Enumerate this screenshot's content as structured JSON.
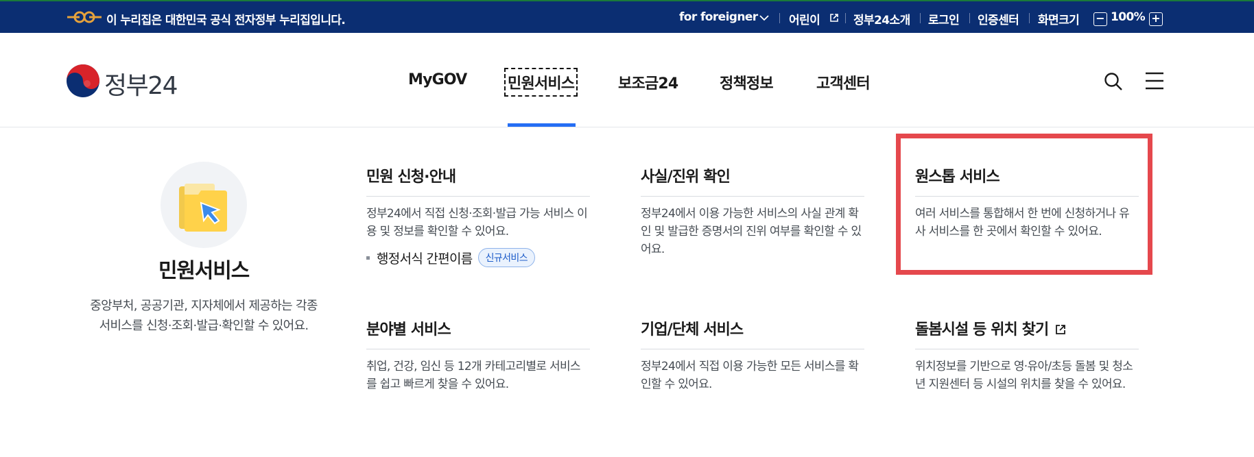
{
  "gov_banner": {
    "text": "이 누리집은 대한민국 공식 전자정부 누리집입니다.",
    "utility_links": [
      "for foreigner",
      "어린이",
      "정부24소개",
      "로그인",
      "인증센터"
    ],
    "zoom_label": "화면크기",
    "zoom_minus": "−",
    "zoom_value": "100%",
    "zoom_plus": "+"
  },
  "header": {
    "logo_text": "정부24",
    "nav": [
      "MyGOV",
      "민원서비스",
      "보조금24",
      "정책정보",
      "고객센터"
    ],
    "active_nav": "민원서비스"
  },
  "mega_menu": {
    "intro": {
      "title": "민원서비스",
      "description": "중앙부처, 공공기관, 지자체에서 제공하는 각종 서비스를 신청·조회·발급·확인할 수 있어요."
    },
    "cards": [
      {
        "title": "민원 신청·안내",
        "description": "정부24에서 직접 신청·조회·발급 가능 서비스 이용 및 정보를 확인할 수 있어요.",
        "sub_link": "행정서식 간편이름",
        "sub_badge": "신규서비스"
      },
      {
        "title": "사실/진위 확인",
        "description": "정부24에서 이용 가능한 서비스의 사실 관계 확인 및 발급한 증명서의 진위 여부를 확인할 수 있어요."
      },
      {
        "title": "원스톱 서비스",
        "description": "여러 서비스를 통합해서 한 번에 신청하거나 유사 서비스를 한 곳에서 확인할 수 있어요."
      },
      {
        "title": "분야별 서비스",
        "description": "취업, 건강, 임신 등 12개 카테고리별로 서비스를 쉽고 빠르게 찾을 수 있어요."
      },
      {
        "title": "기업/단체 서비스",
        "description": "정부24에서 직접 이용 가능한 모든 서비스를 확인할 수 있어요."
      },
      {
        "title": "돌봄시설 등 위치 찾기",
        "description": "위치정보를 기반으로 영·유아/초등 돌봄 및 청소년 지원센터 등 시설의 위치를 찾을 수 있어요."
      }
    ]
  },
  "colors": {
    "gov_bar": "#0b2e72",
    "accent_blue": "#256ef4",
    "highlight_red": "#e5484d"
  },
  "icons": [
    "gov-emblem-icon",
    "chevron-down-icon",
    "external-link-icon",
    "search-icon",
    "menu-icon",
    "folder-cursor-icon"
  ]
}
